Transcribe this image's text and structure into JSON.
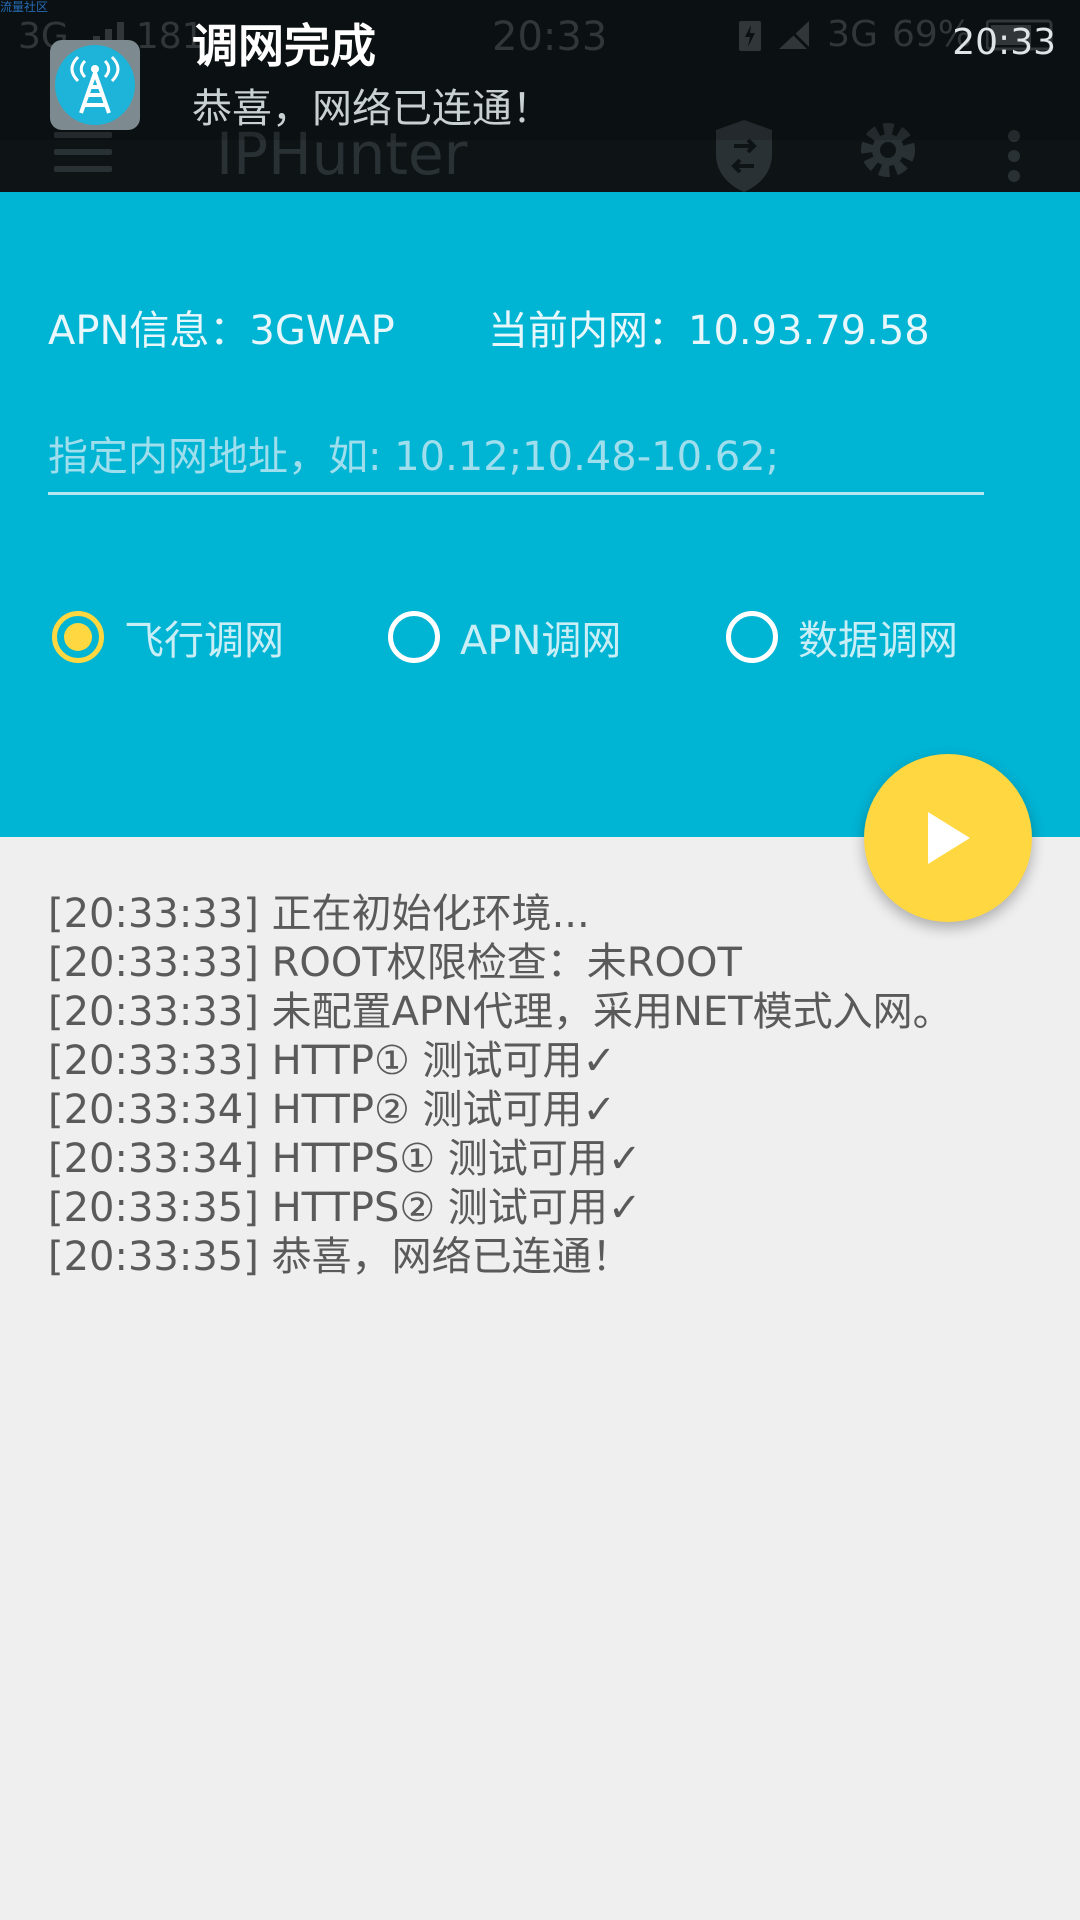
{
  "status_bar": {
    "network": "3G",
    "data_rate": "181",
    "time": "20:33",
    "mobile_data": "3G",
    "battery": "69%"
  },
  "watermark": "流量社区",
  "app_bar": {
    "title": "IPHunter"
  },
  "notification": {
    "title": "调网完成",
    "text": "恭喜，网络已连通！",
    "time": "20:33"
  },
  "panel": {
    "apn_info": "APN信息：3GWAP",
    "current_ip": "当前内网：10.93.79.58",
    "ip_input": {
      "value": "",
      "placeholder": "指定内网地址，如: 10.12;10.48-10.62;"
    },
    "modes": [
      {
        "label": "飞行调网",
        "selected": true
      },
      {
        "label": "APN调网",
        "selected": false
      },
      {
        "label": "数据调网",
        "selected": false
      }
    ]
  },
  "log_lines": [
    "[20:33:33] 正在初始化环境...",
    "[20:33:33] ROOT权限检查：未ROOT",
    "[20:33:33] 未配置APN代理，采用NET模式入网。",
    "[20:33:33] HTTP①   测试可用✓",
    "[20:33:34] HTTP②   测试可用✓",
    "[20:33:34] HTTPS① 测试可用✓",
    "[20:33:35] HTTPS② 测试可用✓",
    "[20:33:35] 恭喜，网络已连通！"
  ],
  "colors": {
    "panel": "#00b4d4",
    "accent": "#ffd740",
    "background": "#efefef",
    "topbar": "#0e1316"
  },
  "icons": {
    "notification": "cell-tower-icon",
    "shield": "shield-swap-icon",
    "settings": "gear-icon",
    "overflow": "more-vert-icon",
    "fab": "play-icon"
  }
}
